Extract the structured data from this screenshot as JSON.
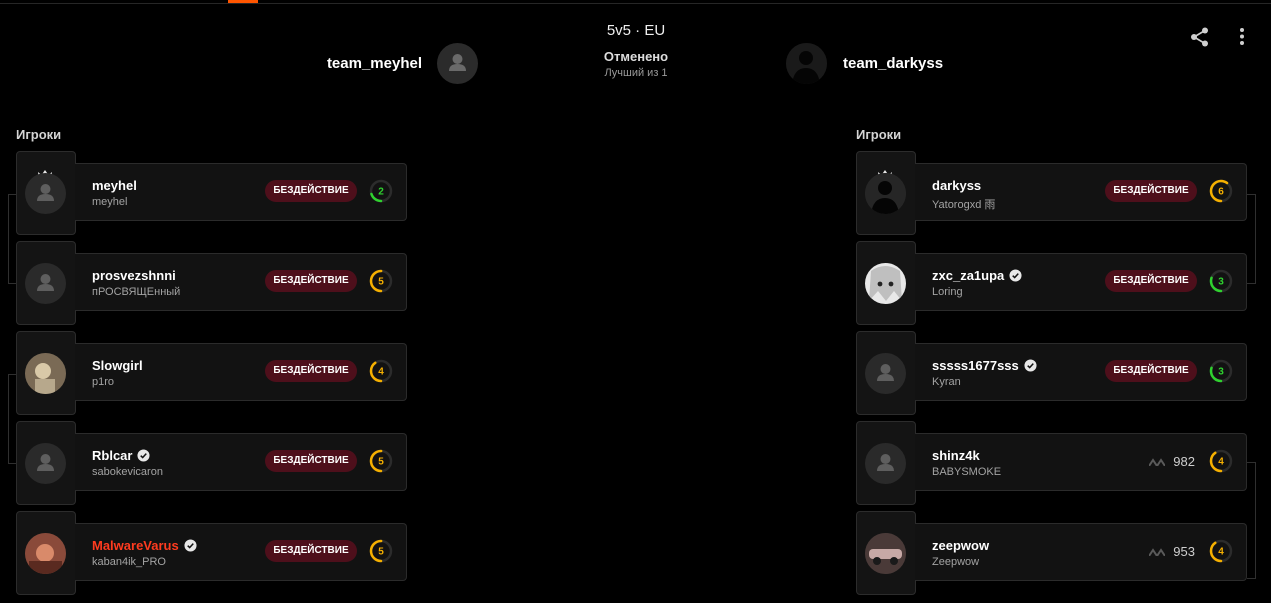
{
  "header": {
    "mode": "5v5 · EU",
    "status": "Отменено",
    "format": "Лучший из 1"
  },
  "teams": {
    "left": {
      "name": "team_meyhel",
      "avatar_icon": "default-avatar"
    },
    "right": {
      "name": "team_darkyss",
      "avatar_icon": "dark-silhouette-avatar"
    }
  },
  "toolbar": {
    "share_icon": "share-icon",
    "more_icon": "more-vertical-icon"
  },
  "colors": {
    "accent": "#ff5500",
    "badge_bg": "#4e0f1b",
    "level_yellow": "#f5b000",
    "level_green": "#2fd12f",
    "highlight_name": "#ff3b1f"
  },
  "left_players": {
    "heading": "Игроки",
    "items": [
      {
        "nickname": "meyhel",
        "subname": "meyhel",
        "status": "БЕЗДЕЙСТВИЕ",
        "level": "2",
        "level_fraction": 0.2,
        "level_color": "#2fd12f",
        "captain": true,
        "verified": false
      },
      {
        "nickname": "prosvezshnni",
        "subname": "пРОСВЯЩЕнный",
        "status": "БЕЗДЕЙСТВИЕ",
        "level": "5",
        "level_fraction": 0.5,
        "level_color": "#f5b000",
        "captain": false,
        "verified": false
      },
      {
        "nickname": "Slowgirl",
        "subname": "p1ro",
        "status": "БЕЗДЕЙСТВИЕ",
        "level": "4",
        "level_fraction": 0.4,
        "level_color": "#f5b000",
        "captain": false,
        "verified": false
      },
      {
        "nickname": "Rblcar",
        "subname": "sabokevicaron",
        "status": "БЕЗДЕЙСТВИЕ",
        "level": "5",
        "level_fraction": 0.5,
        "level_color": "#f5b000",
        "captain": false,
        "verified": true
      },
      {
        "nickname": "MalwareVarus",
        "subname": "kaban4ik_PRO",
        "status": "БЕЗДЕЙСТВИЕ",
        "level": "5",
        "level_fraction": 0.5,
        "level_color": "#f5b000",
        "captain": false,
        "verified": true
      }
    ]
  },
  "right_players": {
    "heading": "Игроки",
    "items": [
      {
        "nickname": "darkyss",
        "subname": "Yatorogxd 雨",
        "status": "БЕЗДЕЙСТВИЕ",
        "level": "6",
        "level_fraction": 0.6,
        "level_color": "#f5b000",
        "captain": true,
        "verified": false
      },
      {
        "nickname": "zxc_za1upa",
        "subname": "Loring",
        "status": "БЕЗДЕЙСТВИЕ",
        "level": "3",
        "level_fraction": 0.3,
        "level_color": "#2fd12f",
        "captain": false,
        "verified": true
      },
      {
        "nickname": "sssss1677sss",
        "subname": "Kyran",
        "status": "БЕЗДЕЙСТВИЕ",
        "level": "3",
        "level_fraction": 0.3,
        "level_color": "#2fd12f",
        "captain": false,
        "verified": true
      },
      {
        "nickname": "shinz4k",
        "subname": "BABYSMOKE",
        "elo": "982",
        "level": "4",
        "level_fraction": 0.4,
        "level_color": "#f5b000",
        "captain": false,
        "verified": false
      },
      {
        "nickname": "zeepwow",
        "subname": "Zeepwow",
        "elo": "953",
        "level": "4",
        "level_fraction": 0.4,
        "level_color": "#f5b000",
        "captain": false,
        "verified": false
      }
    ]
  }
}
